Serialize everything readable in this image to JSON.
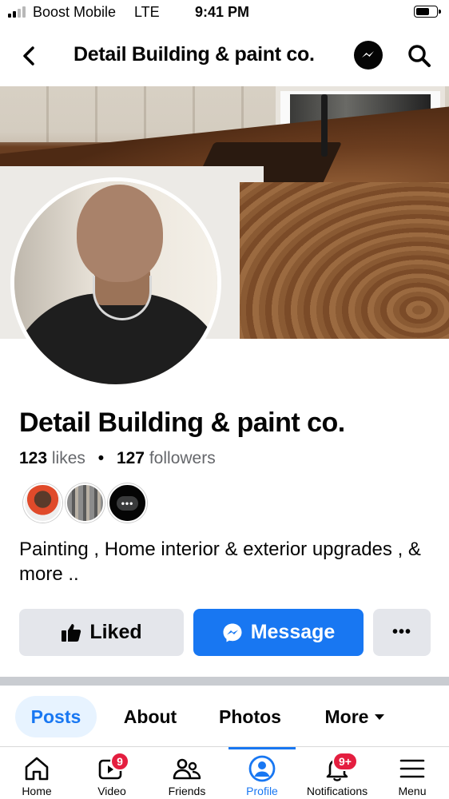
{
  "status_bar": {
    "carrier": "Boost Mobile",
    "network": "LTE",
    "time": "9:41 PM",
    "signal_bars_on": 2,
    "signal_bars_total": 4,
    "battery_level": 0.7
  },
  "header": {
    "title": "Detail Building & paint co.",
    "back_icon": "chevron-left-icon",
    "messenger_icon": "messenger-icon",
    "search_icon": "search-icon"
  },
  "profile": {
    "name": "Detail Building & paint co.",
    "likes_count": "123",
    "likes_label": "likes",
    "separator": "•",
    "followers_count": "127",
    "followers_label": "followers",
    "description": "Painting , Home interior & exterior  upgrades , & more ..",
    "friend_more": "•••"
  },
  "actions": {
    "liked_label": "Liked",
    "message_label": "Message",
    "more_label": "•••"
  },
  "tabs": [
    {
      "label": "Posts",
      "active": true
    },
    {
      "label": "About",
      "active": false
    },
    {
      "label": "Photos",
      "active": false
    },
    {
      "label": "More",
      "active": false
    }
  ],
  "bottom_nav": [
    {
      "label": "Home",
      "icon": "home-icon",
      "badge": ""
    },
    {
      "label": "Video",
      "icon": "video-icon",
      "badge": "9"
    },
    {
      "label": "Friends",
      "icon": "friends-icon",
      "badge": ""
    },
    {
      "label": "Profile",
      "icon": "profile-icon",
      "badge": "",
      "active": true
    },
    {
      "label": "Notifications",
      "icon": "bell-icon",
      "badge": "9+"
    },
    {
      "label": "Menu",
      "icon": "menu-icon",
      "badge": ""
    }
  ],
  "colors": {
    "accent": "#1877f2",
    "badge": "#e41e3f",
    "button_gray": "#e4e6eb",
    "muted_text": "#65676b"
  }
}
